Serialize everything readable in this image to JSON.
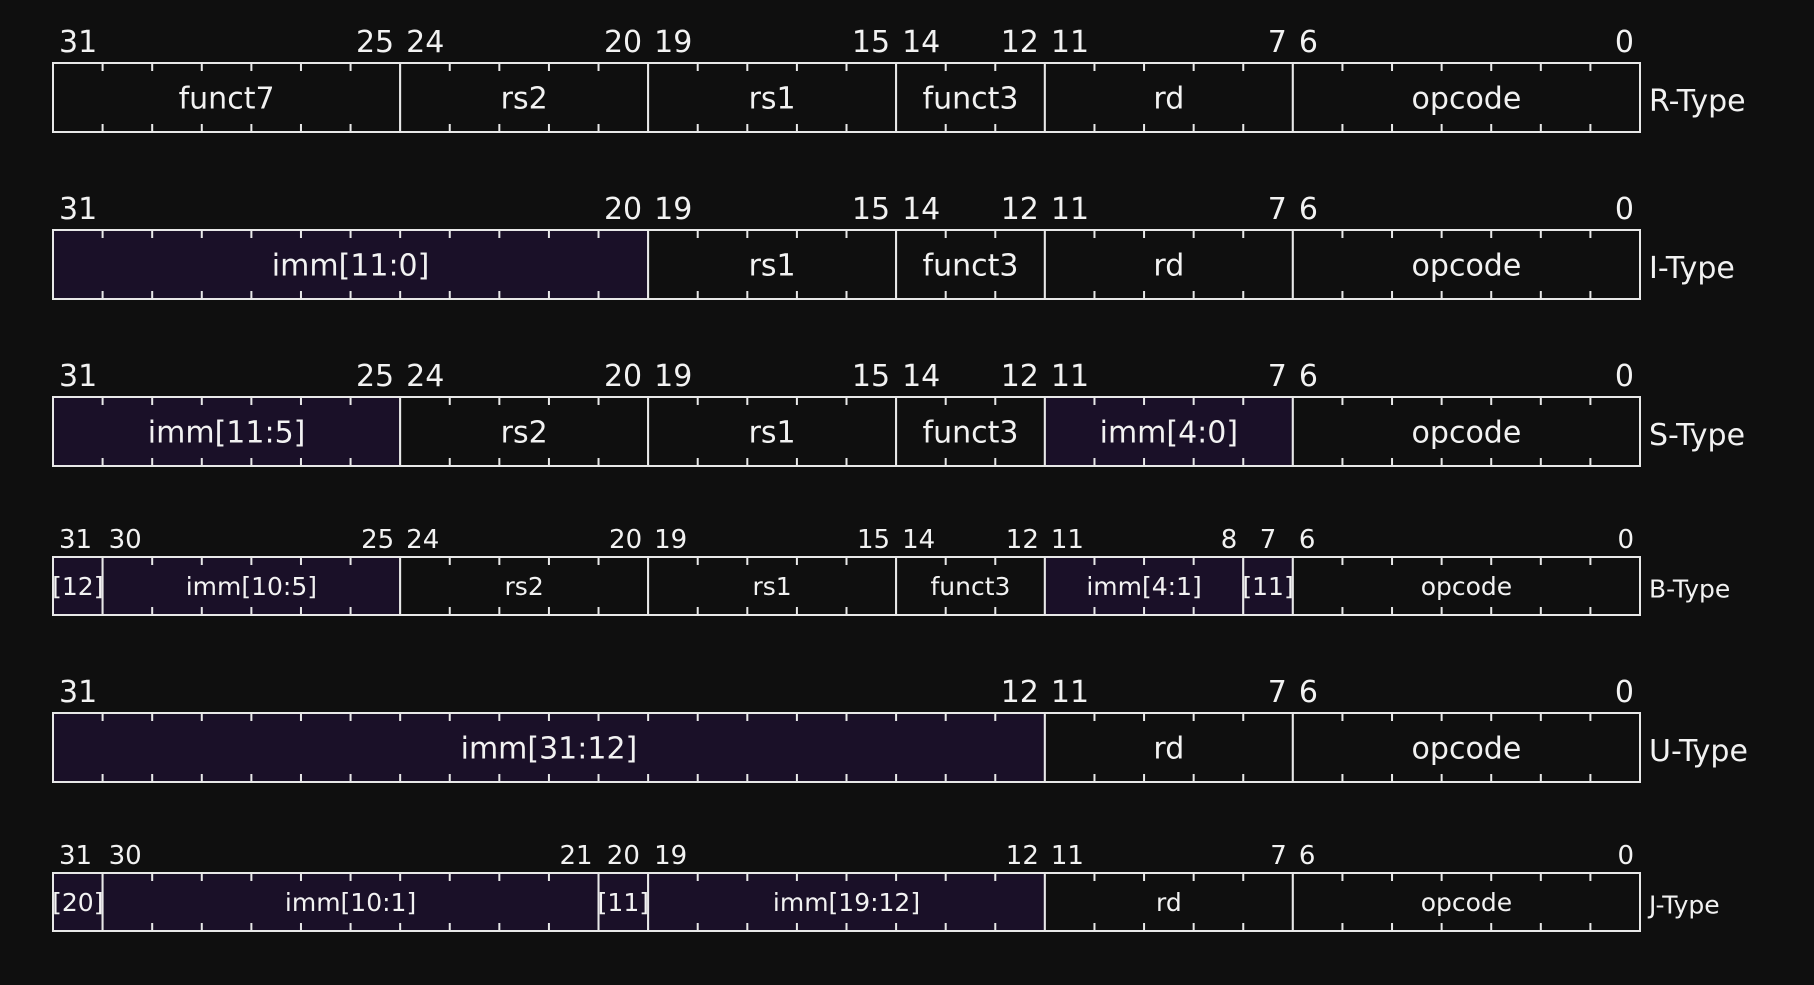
{
  "colors": {
    "background": "#0f0f0f",
    "line": "#e8e8e8",
    "text": "#f2f2f2",
    "immediate_fill": "#1a1028"
  },
  "formats": [
    {
      "label": "R-Type",
      "fields": [
        {
          "text": "funct7",
          "hi": 31,
          "lo": 25,
          "imm": false
        },
        {
          "text": "rs2",
          "hi": 24,
          "lo": 20,
          "imm": false
        },
        {
          "text": "rs1",
          "hi": 19,
          "lo": 15,
          "imm": false
        },
        {
          "text": "funct3",
          "hi": 14,
          "lo": 12,
          "imm": false
        },
        {
          "text": "rd",
          "hi": 11,
          "lo": 7,
          "imm": false
        },
        {
          "text": "opcode",
          "hi": 6,
          "lo": 0,
          "imm": false
        }
      ],
      "bit_labels": [
        {
          "text": "31",
          "bit": 31,
          "side": "left"
        },
        {
          "text": "25",
          "bit": 25,
          "side": "right"
        },
        {
          "text": "24",
          "bit": 24,
          "side": "left"
        },
        {
          "text": "20",
          "bit": 20,
          "side": "right"
        },
        {
          "text": "19",
          "bit": 19,
          "side": "left"
        },
        {
          "text": "15",
          "bit": 15,
          "side": "right"
        },
        {
          "text": "14",
          "bit": 14,
          "side": "left"
        },
        {
          "text": "12",
          "bit": 12,
          "side": "right"
        },
        {
          "text": "11",
          "bit": 11,
          "side": "left"
        },
        {
          "text": "7",
          "bit": 7,
          "side": "right"
        },
        {
          "text": "6",
          "bit": 6,
          "side": "left"
        },
        {
          "text": "0",
          "bit": 0,
          "side": "right"
        }
      ]
    },
    {
      "label": "I-Type",
      "fields": [
        {
          "text": "imm[11:0]",
          "hi": 31,
          "lo": 20,
          "imm": true
        },
        {
          "text": "rs1",
          "hi": 19,
          "lo": 15,
          "imm": false
        },
        {
          "text": "funct3",
          "hi": 14,
          "lo": 12,
          "imm": false
        },
        {
          "text": "rd",
          "hi": 11,
          "lo": 7,
          "imm": false
        },
        {
          "text": "opcode",
          "hi": 6,
          "lo": 0,
          "imm": false
        }
      ],
      "bit_labels": [
        {
          "text": "31",
          "bit": 31,
          "side": "left"
        },
        {
          "text": "20",
          "bit": 20,
          "side": "right"
        },
        {
          "text": "19",
          "bit": 19,
          "side": "left"
        },
        {
          "text": "15",
          "bit": 15,
          "side": "right"
        },
        {
          "text": "14",
          "bit": 14,
          "side": "left"
        },
        {
          "text": "12",
          "bit": 12,
          "side": "right"
        },
        {
          "text": "11",
          "bit": 11,
          "side": "left"
        },
        {
          "text": "7",
          "bit": 7,
          "side": "right"
        },
        {
          "text": "6",
          "bit": 6,
          "side": "left"
        },
        {
          "text": "0",
          "bit": 0,
          "side": "right"
        }
      ]
    },
    {
      "label": "S-Type",
      "fields": [
        {
          "text": "imm[11:5]",
          "hi": 31,
          "lo": 25,
          "imm": true
        },
        {
          "text": "rs2",
          "hi": 24,
          "lo": 20,
          "imm": false
        },
        {
          "text": "rs1",
          "hi": 19,
          "lo": 15,
          "imm": false
        },
        {
          "text": "funct3",
          "hi": 14,
          "lo": 12,
          "imm": false
        },
        {
          "text": "imm[4:0]",
          "hi": 11,
          "lo": 7,
          "imm": true
        },
        {
          "text": "opcode",
          "hi": 6,
          "lo": 0,
          "imm": false
        }
      ],
      "bit_labels": [
        {
          "text": "31",
          "bit": 31,
          "side": "left"
        },
        {
          "text": "25",
          "bit": 25,
          "side": "right"
        },
        {
          "text": "24",
          "bit": 24,
          "side": "left"
        },
        {
          "text": "20",
          "bit": 20,
          "side": "right"
        },
        {
          "text": "19",
          "bit": 19,
          "side": "left"
        },
        {
          "text": "15",
          "bit": 15,
          "side": "right"
        },
        {
          "text": "14",
          "bit": 14,
          "side": "left"
        },
        {
          "text": "12",
          "bit": 12,
          "side": "right"
        },
        {
          "text": "11",
          "bit": 11,
          "side": "left"
        },
        {
          "text": "7",
          "bit": 7,
          "side": "right"
        },
        {
          "text": "6",
          "bit": 6,
          "side": "left"
        },
        {
          "text": "0",
          "bit": 0,
          "side": "right"
        }
      ]
    },
    {
      "label": "B-Type",
      "compact": true,
      "fields": [
        {
          "text": "[12]",
          "hi": 31,
          "lo": 31,
          "imm": true
        },
        {
          "text": "imm[10:5]",
          "hi": 30,
          "lo": 25,
          "imm": true
        },
        {
          "text": "rs2",
          "hi": 24,
          "lo": 20,
          "imm": false
        },
        {
          "text": "rs1",
          "hi": 19,
          "lo": 15,
          "imm": false
        },
        {
          "text": "funct3",
          "hi": 14,
          "lo": 12,
          "imm": false
        },
        {
          "text": "imm[4:1]",
          "hi": 11,
          "lo": 8,
          "imm": true
        },
        {
          "text": "[11]",
          "hi": 7,
          "lo": 7,
          "imm": true
        },
        {
          "text": "opcode",
          "hi": 6,
          "lo": 0,
          "imm": false
        }
      ],
      "bit_labels": [
        {
          "text": "31",
          "bit": 31,
          "side": "left"
        },
        {
          "text": "30",
          "bit": 30,
          "side": "left"
        },
        {
          "text": "25",
          "bit": 25,
          "side": "right"
        },
        {
          "text": "24",
          "bit": 24,
          "side": "left"
        },
        {
          "text": "20",
          "bit": 20,
          "side": "right"
        },
        {
          "text": "19",
          "bit": 19,
          "side": "left"
        },
        {
          "text": "15",
          "bit": 15,
          "side": "right"
        },
        {
          "text": "14",
          "bit": 14,
          "side": "left"
        },
        {
          "text": "12",
          "bit": 12,
          "side": "right"
        },
        {
          "text": "11",
          "bit": 11,
          "side": "left"
        },
        {
          "text": "8",
          "bit": 8,
          "side": "right"
        },
        {
          "text": "7",
          "bit": 7,
          "side": "center"
        },
        {
          "text": "6",
          "bit": 6,
          "side": "left"
        },
        {
          "text": "0",
          "bit": 0,
          "side": "right"
        }
      ]
    },
    {
      "label": "U-Type",
      "fields": [
        {
          "text": "imm[31:12]",
          "hi": 31,
          "lo": 12,
          "imm": true
        },
        {
          "text": "rd",
          "hi": 11,
          "lo": 7,
          "imm": false
        },
        {
          "text": "opcode",
          "hi": 6,
          "lo": 0,
          "imm": false
        }
      ],
      "bit_labels": [
        {
          "text": "31",
          "bit": 31,
          "side": "left"
        },
        {
          "text": "12",
          "bit": 12,
          "side": "right"
        },
        {
          "text": "11",
          "bit": 11,
          "side": "left"
        },
        {
          "text": "7",
          "bit": 7,
          "side": "right"
        },
        {
          "text": "6",
          "bit": 6,
          "side": "left"
        },
        {
          "text": "0",
          "bit": 0,
          "side": "right"
        }
      ]
    },
    {
      "label": "J-Type",
      "compact": true,
      "fields": [
        {
          "text": "[20]",
          "hi": 31,
          "lo": 31,
          "imm": true
        },
        {
          "text": "imm[10:1]",
          "hi": 30,
          "lo": 21,
          "imm": true
        },
        {
          "text": "[11]",
          "hi": 20,
          "lo": 20,
          "imm": true
        },
        {
          "text": "imm[19:12]",
          "hi": 19,
          "lo": 12,
          "imm": true
        },
        {
          "text": "rd",
          "hi": 11,
          "lo": 7,
          "imm": false
        },
        {
          "text": "opcode",
          "hi": 6,
          "lo": 0,
          "imm": false
        }
      ],
      "bit_labels": [
        {
          "text": "31",
          "bit": 31,
          "side": "left"
        },
        {
          "text": "30",
          "bit": 30,
          "side": "left"
        },
        {
          "text": "21",
          "bit": 21,
          "side": "right"
        },
        {
          "text": "20",
          "bit": 20,
          "side": "center"
        },
        {
          "text": "19",
          "bit": 19,
          "side": "left"
        },
        {
          "text": "12",
          "bit": 12,
          "side": "right"
        },
        {
          "text": "11",
          "bit": 11,
          "side": "left"
        },
        {
          "text": "7",
          "bit": 7,
          "side": "right"
        },
        {
          "text": "6",
          "bit": 6,
          "side": "left"
        },
        {
          "text": "0",
          "bit": 0,
          "side": "right"
        }
      ]
    }
  ]
}
